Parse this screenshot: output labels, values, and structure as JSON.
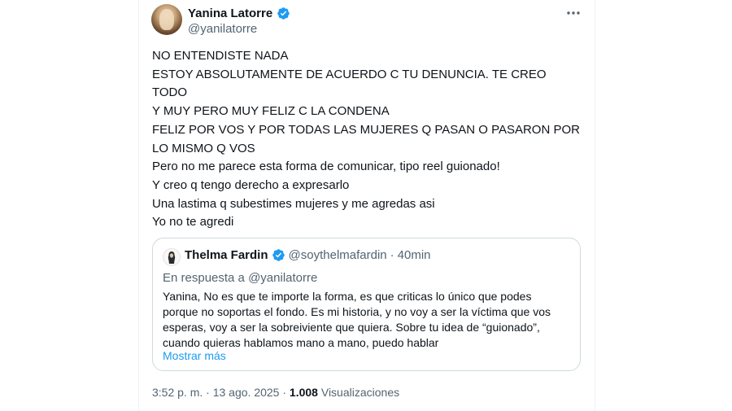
{
  "author": {
    "display_name": "Yanina Latorre",
    "handle": "@yanilatorre",
    "verified_badge_icon": "verified-badge-icon",
    "verified_color": "#1d9bf0"
  },
  "menu": {
    "more_icon": "more-horizontal-icon"
  },
  "tweet": {
    "lines": [
      "NO ENTENDISTE NADA",
      "ESTOY ABSOLUTAMENTE DE ACUERDO C TU DENUNCIA. TE CREO",
      "TODO",
      "Y MUY PERO MUY FELIZ C LA CONDENA",
      "FELIZ POR VOS Y POR TODAS LAS MUJERES Q PASAN O PASARON POR",
      "LO MISMO Q VOS",
      "Pero no me parece esta forma de comunicar, tipo reel guionado!",
      "Y creo q tengo derecho a expresarlo",
      "Una lastima q subestimes mujeres y me agredas asi",
      "Yo no te agredi"
    ]
  },
  "quote": {
    "display_name": "Thelma Fardin",
    "handle": "@soythelmafardin",
    "separator": "·",
    "time": "40min",
    "reply_prefix": "En respuesta a",
    "reply_to": "@yanilatorre",
    "lines": [
      "Yanina, No es que te importe la forma, es que criticas lo único que podes",
      "porque no soportas el fondo. Es mi historia, y no voy a ser la víctima que vos",
      "esperas, voy a ser la sobreiviente que quiera. Sobre tu idea de “guionado”,",
      "cuando quieras hablamos mano a mano, puedo hablar"
    ],
    "show_more": "Mostrar más"
  },
  "footer": {
    "time": "3:52 p. m.",
    "separator": "·",
    "date": "13 ago. 2025",
    "views": "1.008",
    "views_label": "Visualizaciones"
  },
  "colors": {
    "text": "#0f1419",
    "secondary": "#536471",
    "link": "#1d9bf0",
    "border": "#cfd9de"
  }
}
